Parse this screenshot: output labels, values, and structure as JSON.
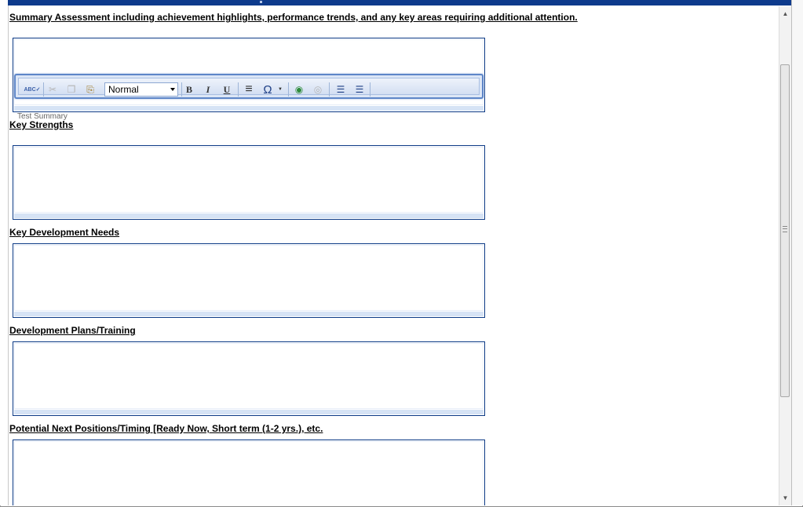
{
  "sections": [
    {
      "label": "Summary Assessment including achievement highlights, performance trends, and any key areas requiring additional attention."
    },
    {
      "label": "Key Strengths"
    },
    {
      "label": "Key Development Needs"
    },
    {
      "label": "Development Plans/Training"
    },
    {
      "label": "Potential Next Positions/Timing [Ready Now, Short term (1-2 yrs.), etc."
    }
  ],
  "toolbar": {
    "format_value": "Normal",
    "buttons": [
      {
        "name": "spellcheck-icon",
        "glyph": "ABC✓"
      },
      {
        "name": "cut-icon",
        "glyph": "✂"
      },
      {
        "name": "copy-icon",
        "glyph": "❐"
      },
      {
        "name": "paste-icon",
        "glyph": "⎘"
      },
      {
        "name": "bold-icon",
        "glyph": "B"
      },
      {
        "name": "italic-icon",
        "glyph": "I"
      },
      {
        "name": "underline-icon",
        "glyph": "U"
      },
      {
        "name": "align-icon",
        "glyph": "≡"
      },
      {
        "name": "special-char-icon",
        "glyph": "Ω"
      },
      {
        "name": "link-icon",
        "glyph": "◉"
      },
      {
        "name": "unlink-icon",
        "glyph": "◎"
      },
      {
        "name": "numbered-list-icon",
        "glyph": "☰"
      },
      {
        "name": "bullet-list-icon",
        "glyph": "☰"
      }
    ]
  },
  "summary_caption": "Test Summary",
  "colors": {
    "accent": "#0d3a8c",
    "editor_border": "#0c3a86",
    "toolbar_bg": "#dce6f6"
  }
}
